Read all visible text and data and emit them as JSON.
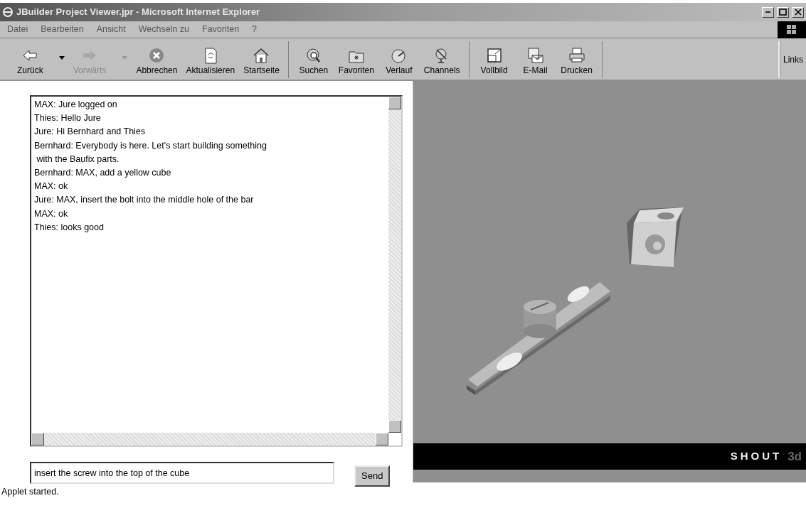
{
  "window": {
    "title": "JBuilder Project Viewer.jpr - Microsoft Internet Explorer"
  },
  "menu": [
    "Datei",
    "Bearbeiten",
    "Ansicht",
    "Wechseln zu",
    "Favoriten",
    "?"
  ],
  "toolbar": {
    "groups": [
      [
        {
          "label": "Zurück",
          "disabled": false,
          "dropdown": true
        },
        {
          "label": "Vorwärts",
          "disabled": true,
          "dropdown": true
        },
        {
          "label": "Abbrechen",
          "disabled": false,
          "dropdown": false
        },
        {
          "label": "Aktualisieren",
          "disabled": false,
          "dropdown": false
        },
        {
          "label": "Startseite",
          "disabled": false,
          "dropdown": false
        }
      ],
      [
        {
          "label": "Suchen",
          "disabled": false,
          "dropdown": false
        },
        {
          "label": "Favoriten",
          "disabled": false,
          "dropdown": false
        },
        {
          "label": "Verlauf",
          "disabled": false,
          "dropdown": false
        },
        {
          "label": "Channels",
          "disabled": false,
          "dropdown": false
        }
      ],
      [
        {
          "label": "Vollbild",
          "disabled": false,
          "dropdown": false
        },
        {
          "label": "E-Mail",
          "disabled": false,
          "dropdown": false
        },
        {
          "label": "Drucken",
          "disabled": false,
          "dropdown": false
        }
      ]
    ],
    "links": "Links"
  },
  "chat": {
    "lines": [
      "MAX: Jure logged on",
      "Thies: Hello Jure",
      "Jure: Hi Bernhard and Thies",
      "Bernhard: Everybody is here. Let's start building something",
      " with the Baufix parts.",
      "Bernhard: MAX, add a yellow cube",
      "MAX: ok",
      "Jure: MAX, insert the bolt into the middle hole of the bar",
      "MAX: ok",
      "Thies: looks good"
    ],
    "input": "insert the screw into the top of the cube",
    "send": "Send"
  },
  "viewer": {
    "logo_text": "SHOUT",
    "logo_suffix": "3d"
  },
  "status_bar": "Applet started."
}
